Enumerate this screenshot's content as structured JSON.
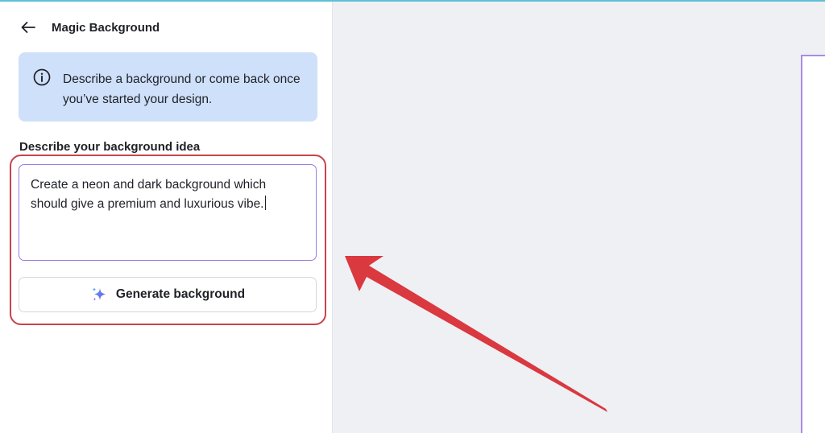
{
  "panel": {
    "title": "Magic Background",
    "back_icon": "arrow-left-icon",
    "info": {
      "icon": "info-circle-icon",
      "text": "Describe a background or come back once you’ve started your design."
    },
    "field": {
      "label": "Describe your background idea",
      "value": "Create a neon and dark background which should give a premium and luxurious vibe."
    },
    "generate_button": {
      "icon": "sparkle-icon",
      "label": "Generate background"
    }
  },
  "annotation": {
    "highlight_color": "#c9434a",
    "arrow_color": "#d9393f"
  },
  "colors": {
    "info_bg": "#cfe0fb",
    "field_border": "#9a7ce0",
    "canvas_bg": "#eff0f4",
    "accent_line": "#5fc0d6"
  }
}
